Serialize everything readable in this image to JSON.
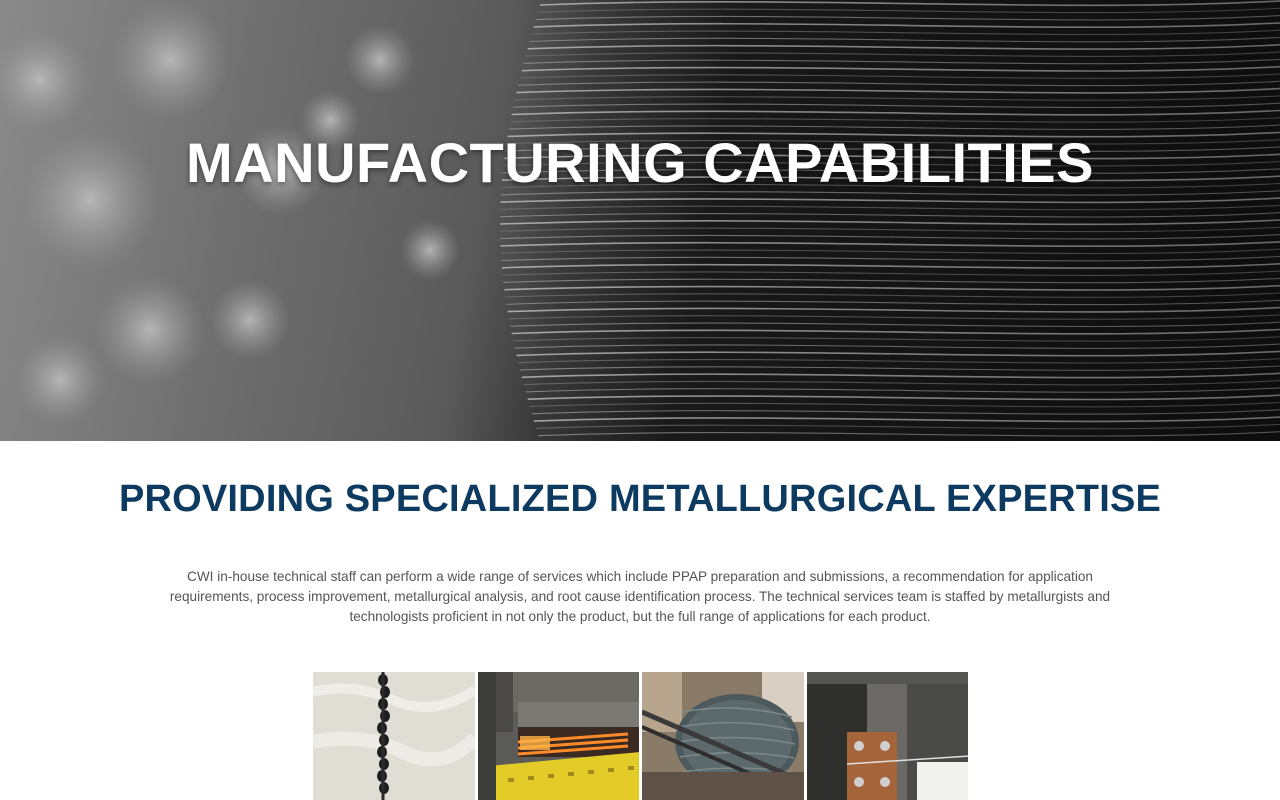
{
  "hero": {
    "title": "MANUFACTURING CAPABILITIES",
    "image": "wire-coil-background"
  },
  "section": {
    "heading": "PROVIDING SPECIALIZED METALLURGICAL EXPERTISE",
    "body": "CWI in-house technical staff can perform a wide range of services which include PPAP preparation and submissions, a recommendation for application requirements, process improvement, metallurgical analysis, and root cause identification process. The technical services team is staffed by metallurgists and technologists proficient in not only the product, but the full range of applications for each product."
  },
  "gallery": {
    "images": [
      {
        "name": "wire-chain-on-fabric-photo"
      },
      {
        "name": "heat-treatment-furnace-photo"
      },
      {
        "name": "wire-coil-spool-photo"
      },
      {
        "name": "wire-testing-fixture-photo"
      }
    ]
  },
  "colors": {
    "heading": "#0d3a60",
    "body_text": "#555555",
    "hero_text": "#ffffff"
  }
}
